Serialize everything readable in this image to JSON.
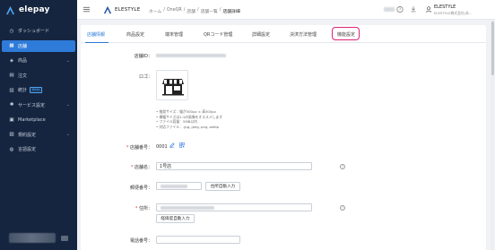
{
  "brand": {
    "name": "elepay"
  },
  "sidebar": {
    "items": [
      {
        "label": "ダッシュボード",
        "icon": "dashboard-icon",
        "active": false,
        "chevron": false
      },
      {
        "label": "店舗",
        "icon": "store-icon",
        "active": true,
        "chevron": false
      },
      {
        "label": "商品",
        "icon": "tag-icon",
        "active": false,
        "chevron": true
      },
      {
        "label": "注文",
        "icon": "order-icon",
        "active": false,
        "chevron": false
      },
      {
        "label": "統計",
        "icon": "chart-icon",
        "active": false,
        "chevron": false,
        "badge": "Beta"
      },
      {
        "label": "サービス設定",
        "icon": "gear-icon",
        "active": false,
        "chevron": true
      },
      {
        "label": "Marketplace",
        "icon": "grid-icon",
        "active": false,
        "chevron": false
      },
      {
        "label": "規約設定",
        "icon": "document-icon",
        "active": false,
        "chevron": true
      },
      {
        "label": "言語設定",
        "icon": "language-icon",
        "active": false,
        "chevron": false
      }
    ]
  },
  "header": {
    "app_name": "ELESTYLE",
    "breadcrumb": [
      "ホーム",
      "/",
      "OneQR",
      "/",
      "店舗",
      "/",
      "店舗一覧",
      "/",
      "店舗詳細"
    ],
    "user": {
      "name": "ELESTYLE",
      "company": "ELESTYLE株式会社(本..."
    }
  },
  "tabs": [
    {
      "label": "店舗情報",
      "active": true
    },
    {
      "label": "商品設定",
      "active": false
    },
    {
      "label": "端末管理",
      "active": false
    },
    {
      "label": "QRコード管理",
      "active": false
    },
    {
      "label": "詳細設定",
      "active": false
    },
    {
      "label": "決済方法管理",
      "active": false
    },
    {
      "label": "機能設定",
      "active": false,
      "highlighted": true
    }
  ],
  "form": {
    "store_id_label": "店舗ID：",
    "logo_label": "ロゴ：",
    "logo_notes": [
      "推奨サイズ：幅が300px × 高300px",
      "横幅サイズは1:1の画像をオススメします",
      "ファイル容量：5MB以内",
      "対応ファイル：.jpg,.jpeg,.png,.webp"
    ],
    "store_code_label": "店舗番号：",
    "store_code_value": "0001",
    "store_name_label": "店舗名：",
    "store_name_value": "1号店",
    "postal_label": "郵便番号：",
    "postal_button": "住所自動入力",
    "address_label": "住所：",
    "address_button": "経緯度自動入力",
    "phone_label": "電話番号："
  },
  "colors": {
    "sidebar_bg": "#16253f",
    "accent": "#2f7bd9",
    "highlight": "#e0237a"
  }
}
